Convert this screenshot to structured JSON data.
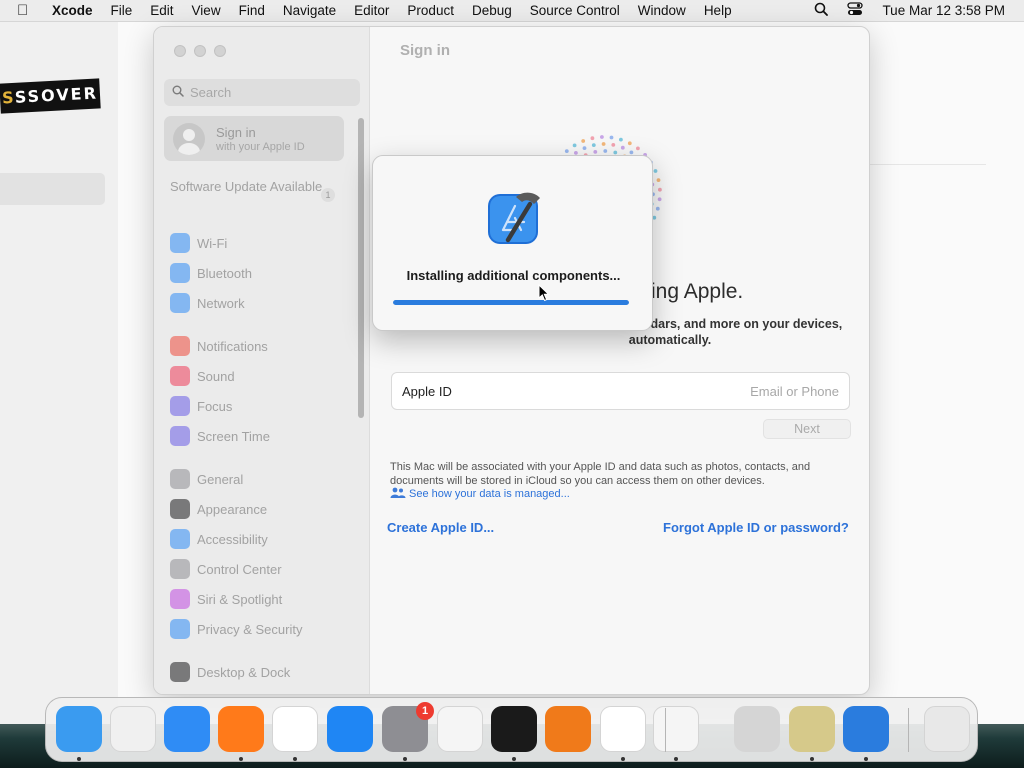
{
  "menubar": {
    "app_name": "Xcode",
    "items": [
      "File",
      "Edit",
      "View",
      "Find",
      "Navigate",
      "Editor",
      "Product",
      "Debug",
      "Source Control",
      "Window",
      "Help"
    ],
    "clock": "Tue Mar 12  3:58 PM"
  },
  "background": {
    "crossover_label": "SSOVER"
  },
  "settings": {
    "search_placeholder": "Search",
    "signin_title": "Sign in",
    "signin_subtitle": "with your Apple ID",
    "software_update": "Software Update Available",
    "update_badge": "1",
    "groups": [
      [
        {
          "label": "Wi-Fi",
          "icon": "wifi-icon",
          "color": "#2f8cf5"
        },
        {
          "label": "Bluetooth",
          "icon": "bluetooth-icon",
          "color": "#2f8cf5"
        },
        {
          "label": "Network",
          "icon": "globe-icon",
          "color": "#2f8cf5"
        }
      ],
      [
        {
          "label": "Notifications",
          "icon": "bell-icon",
          "color": "#ef4a3c"
        },
        {
          "label": "Sound",
          "icon": "speaker-icon",
          "color": "#ef3c5a"
        },
        {
          "label": "Focus",
          "icon": "moon-icon",
          "color": "#6a5ce6"
        },
        {
          "label": "Screen Time",
          "icon": "hourglass-icon",
          "color": "#6a5ce6"
        }
      ],
      [
        {
          "label": "General",
          "icon": "gear-icon",
          "color": "#8e8e93"
        },
        {
          "label": "Appearance",
          "icon": "appearance-icon",
          "color": "#1c1c1e"
        },
        {
          "label": "Accessibility",
          "icon": "accessibility-icon",
          "color": "#2f8cf5"
        },
        {
          "label": "Control Center",
          "icon": "control-center-icon",
          "color": "#8e8e93"
        },
        {
          "label": "Siri & Spotlight",
          "icon": "siri-icon",
          "color": "#c04be0"
        },
        {
          "label": "Privacy & Security",
          "icon": "hand-icon",
          "color": "#2f8cf5"
        }
      ],
      [
        {
          "label": "Desktop & Dock",
          "icon": "dock-icon",
          "color": "#1c1c1e"
        }
      ]
    ],
    "content": {
      "title": "Sign in",
      "headline": "rything Apple.",
      "subline": "e, photos, contacts, calendars, and more on your devices, automatically.",
      "appleid_label": "Apple ID",
      "appleid_placeholder": "Email or Phone",
      "next_label": "Next",
      "privacy_text": "This Mac will be associated with your Apple ID and data such as photos, contacts, and documents will be stored in iCloud so you can access them on other devices.",
      "privacy_link": "See how your data is managed...",
      "create_link": "Create Apple ID...",
      "forgot_link": "Forgot Apple ID or password?"
    }
  },
  "install_dialog": {
    "message": "Installing additional components...",
    "progress": 1.0
  },
  "dock": {
    "items": [
      {
        "name": "finder-icon",
        "color": "#3a9bf0",
        "running": true
      },
      {
        "name": "launchpad-icon",
        "color": "#f0f0f0",
        "running": false
      },
      {
        "name": "safari-icon",
        "color": "#2f8cf5",
        "running": false
      },
      {
        "name": "firefox-icon",
        "color": "#ff7a1a",
        "running": true
      },
      {
        "name": "chrome-icon",
        "color": "#ffffff",
        "running": true
      },
      {
        "name": "app-store-icon",
        "color": "#1f86f4",
        "running": false
      },
      {
        "name": "system-settings-icon",
        "color": "#8e8e93",
        "running": true
      },
      {
        "name": "textedit-icon",
        "color": "#f5f5f5",
        "running": false
      },
      {
        "name": "terminal-icon",
        "color": "#1a1a1a",
        "running": true
      },
      {
        "name": "garageband-icon",
        "color": "#f07a1a",
        "running": false
      },
      {
        "name": "vscode-icon",
        "color": "#ffffff",
        "running": true
      },
      {
        "name": "crossover-icon",
        "color": "#f5f5f5",
        "running": true
      },
      {
        "name": "calculator-icon",
        "color": "#d5d5d5",
        "running": false
      },
      {
        "name": "wine-app-icon",
        "color": "#d6c98a",
        "running": true
      },
      {
        "name": "xcode-icon",
        "color": "#2a7cde",
        "running": true
      },
      {
        "name": "trash-icon",
        "color": "#e8e8e8",
        "running": false
      }
    ],
    "settings_badge": "1"
  }
}
